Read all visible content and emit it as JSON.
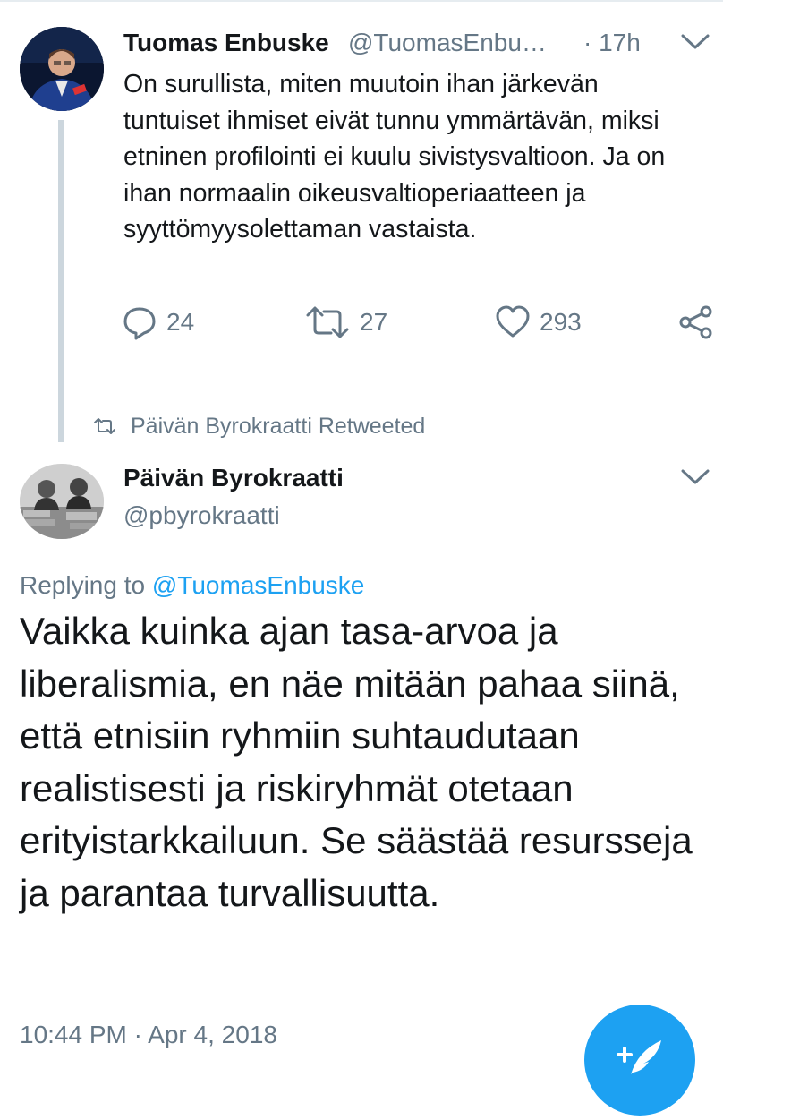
{
  "tweet1": {
    "name": "Tuomas Enbuske",
    "handle": "@TuomasEnbu…",
    "time": "· 17h",
    "text": "On surullista, miten muutoin ihan järkevän tuntuiset ihmiset eivät tunnu ymmärtävän, miksi etninen profilointi ei kuulu sivistysvaltioon. Ja on ihan normaalin oikeusvaltioperiaatteen ja syyttömyysolettaman vastaista.",
    "replies": "24",
    "retweets": "27",
    "likes": "293"
  },
  "retweet_label": "Päivän Byrokraatti Retweeted",
  "tweet2": {
    "name": "Päivän Byrokraatti",
    "handle": "@pbyrokraatti",
    "replying_prefix": "Replying to",
    "replying_to": "@TuomasEnbuske",
    "text": "Vaikka kuinka ajan tasa-arvoa ja liberalismia, en näe mitään pahaa siinä, että etnisiin ryhmiin suhtaudutaan realistisesti ja riskiryhmät otetaan erityistarkkailuun. Se säästää resursseja ja parantaa turvallisuutta.",
    "timestamp": "10:44 PM · Apr 4, 2018"
  },
  "icons": {
    "reply": "reply-icon",
    "retweet": "retweet-icon",
    "like": "heart-icon",
    "share": "share-icon",
    "menu": "chevron-down-icon",
    "compose": "compose-tweet-icon"
  },
  "colors": {
    "accent": "#1da1f2",
    "text": "#14171a",
    "secondary": "#657786",
    "thread_line": "#ccd6dd"
  }
}
